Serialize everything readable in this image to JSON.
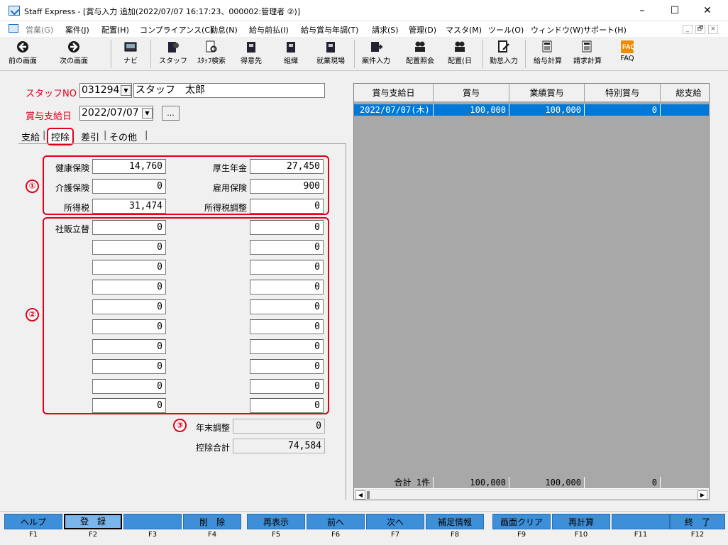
{
  "window": {
    "title": "Staff Express - [賞与入力 追加(2022/07/07 16:17:23、000002:管理者 ②)]",
    "minimize": "–",
    "maximize": "☐",
    "close": "✕"
  },
  "menu": {
    "items": [
      "営業(G)",
      "案件(J)",
      "配置(H)",
      "コンプライアンス(C)",
      "勤怠(N)",
      "給与前払(I)",
      "給与賞与年調(T)",
      "請求(S)",
      "管理(D)",
      "マスタ(M)",
      "ツール(O)",
      "ウィンドウ(W)",
      "サポート(H)"
    ],
    "mdi_min": "_",
    "mdi_restore": "🗗",
    "mdi_close": "×"
  },
  "toolbar": {
    "items": [
      "前の画面",
      "次の画面",
      "ナビ",
      "スタッフ",
      "ｽﾀｯﾌ検索",
      "得意先",
      "組織",
      "就業現場",
      "案件入力",
      "配置照会",
      "配置(日",
      "勤怠入力",
      "給与計算",
      "請求計算",
      "FAQ"
    ]
  },
  "form": {
    "staff_no_label": "スタッフNO",
    "staff_no_value": "031294",
    "staff_name": "スタッフ　太郎",
    "pay_date_label": "賞与支給日",
    "pay_date_value": "2022/07/07",
    "ellipsis": "...",
    "tabs": [
      "支給",
      "控除",
      "差引",
      "その他"
    ],
    "tab_separator": "|"
  },
  "deductions": {
    "group1": [
      {
        "label": "健康保険",
        "value": "14,760"
      },
      {
        "label": "厚生年金",
        "value": "27,450"
      },
      {
        "label": "介護保険",
        "value": "0"
      },
      {
        "label": "雇用保険",
        "value": "900"
      },
      {
        "label": "所得税",
        "value": "31,474"
      },
      {
        "label": "所得税調整",
        "value": "0"
      }
    ],
    "group2_label": "社販立替",
    "group2_left": [
      "0",
      "0",
      "0",
      "0",
      "0",
      "0",
      "0",
      "0",
      "0",
      "0"
    ],
    "group2_right": [
      "0",
      "0",
      "0",
      "0",
      "0",
      "0",
      "0",
      "0",
      "0",
      "0"
    ],
    "year_end_label": "年末調整",
    "year_end_value": "0",
    "total_label": "控除合計",
    "total_value": "74,584",
    "markers": [
      "①",
      "②",
      "③"
    ]
  },
  "grid": {
    "columns": [
      "賞与支給日",
      "賞与",
      "業績賞与",
      "特別賞与",
      "総支給"
    ],
    "row": [
      "2022/07/07(木)",
      "100,000",
      "100,000",
      "0",
      ""
    ],
    "footer": [
      "合計 1件",
      "100,000",
      "100,000",
      "0",
      ""
    ]
  },
  "fkeys": [
    {
      "label": "ヘルプ",
      "key": "F1"
    },
    {
      "label": "登　録",
      "key": "F2"
    },
    {
      "label": "",
      "key": "F3"
    },
    {
      "label": "削　除",
      "key": "F4"
    },
    {
      "label": "再表示",
      "key": "F5"
    },
    {
      "label": "前へ",
      "key": "F6"
    },
    {
      "label": "次へ",
      "key": "F7"
    },
    {
      "label": "補足情報",
      "key": "F8"
    },
    {
      "label": "画面クリア",
      "key": "F9"
    },
    {
      "label": "再計算",
      "key": "F10"
    },
    {
      "label": "",
      "key": "F11"
    },
    {
      "label": "終　了",
      "key": "F12"
    }
  ],
  "colors": {
    "accent_red": "#e0001a",
    "selection_blue": "#0078d7",
    "fkey_blue": "#3c8fd8"
  }
}
